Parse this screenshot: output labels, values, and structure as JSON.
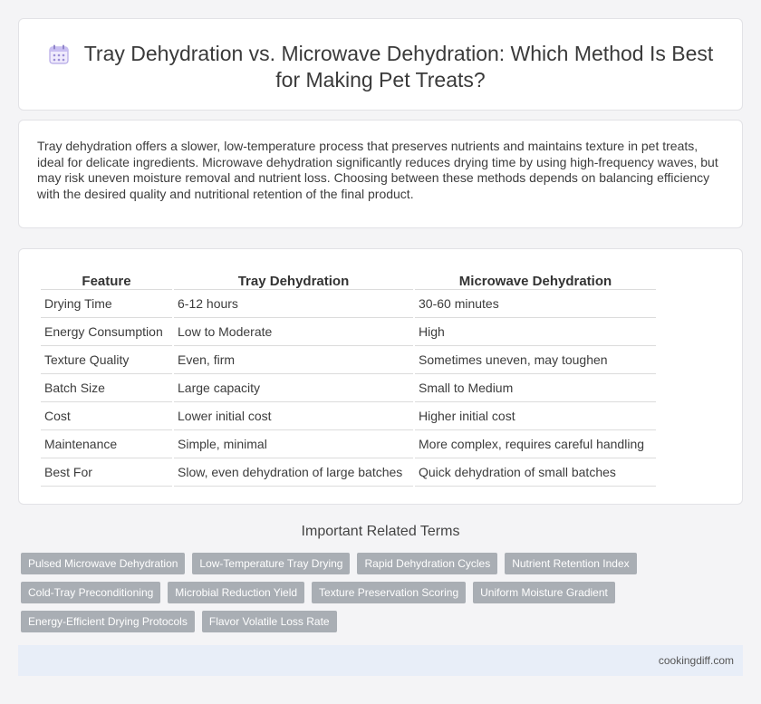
{
  "header": {
    "title": "Tray Dehydration vs. Microwave Dehydration: Which Method Is Best for Making Pet Treats?",
    "icon": "calendar-icon"
  },
  "intro": {
    "text": "Tray dehydration offers a slower, low-temperature process that preserves nutrients and maintains texture in pet treats, ideal for delicate ingredients. Microwave dehydration significantly reduces drying time by using high-frequency waves, but may risk uneven moisture removal and nutrient loss. Choosing between these methods depends on balancing efficiency with the desired quality and nutritional retention of the final product."
  },
  "table": {
    "headers": [
      "Feature",
      "Tray Dehydration",
      "Microwave Dehydration"
    ],
    "rows": [
      [
        "Drying Time",
        "6-12 hours",
        "30-60 minutes"
      ],
      [
        "Energy Consumption",
        "Low to Moderate",
        "High"
      ],
      [
        "Texture Quality",
        "Even, firm",
        "Sometimes uneven, may toughen"
      ],
      [
        "Batch Size",
        "Large capacity",
        "Small to Medium"
      ],
      [
        "Cost",
        "Lower initial cost",
        "Higher initial cost"
      ],
      [
        "Maintenance",
        "Simple, minimal",
        "More complex, requires careful handling"
      ],
      [
        "Best For",
        "Slow, even dehydration of large batches",
        "Quick dehydration of small batches"
      ]
    ]
  },
  "related": {
    "heading": "Important Related Terms",
    "tags": [
      "Pulsed Microwave Dehydration",
      "Low-Temperature Tray Drying",
      "Rapid Dehydration Cycles",
      "Nutrient Retention Index",
      "Cold-Tray Preconditioning",
      "Microbial Reduction Yield",
      "Texture Preservation Scoring",
      "Uniform Moisture Gradient",
      "Energy-Efficient Drying Protocols",
      "Flavor Volatile Loss Rate"
    ]
  },
  "footer": {
    "site": "cookingdiff.com"
  },
  "colors": {
    "tag_bg": "#a9aeb4",
    "footer_bg": "#e8eef8",
    "icon_accent": "#9b8fd6"
  }
}
